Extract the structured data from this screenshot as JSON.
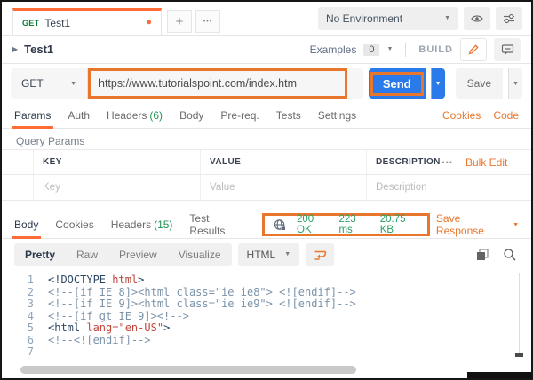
{
  "colors": {
    "accent_orange": "#ff6c37",
    "annotation_orange": "#e8762d",
    "link_orange": "#e8762d",
    "method_green": "#077d3a",
    "count_green": "#1f9254",
    "status_green": "#27a065",
    "send_blue": "#2a7be9"
  },
  "code_colors": {
    "tag": "#2c4964",
    "attr": "#c0473d",
    "string": "#c0473d",
    "comment": "#7b93a9",
    "line_number": "#8da4b8"
  },
  "icons": {
    "plus": "+",
    "more": "•••",
    "chevron": "▼",
    "dot": "●",
    "arrow": "▶",
    "menu": "•••"
  },
  "tabbar": {
    "tab_method": "GET",
    "tab_title": "Test1",
    "environment_selector": "No Environment"
  },
  "header": {
    "request_title": "Test1",
    "examples_label": "Examples",
    "examples_count": "0",
    "build_label": "BUILD"
  },
  "request_bar": {
    "method": "GET",
    "url": "https://www.tutorialspoint.com/index.htm",
    "send": "Send",
    "save": "Save"
  },
  "request_tabs": {
    "items": [
      {
        "label": "Params"
      },
      {
        "label": "Auth"
      },
      {
        "label": "Headers",
        "count": "(6)"
      },
      {
        "label": "Body"
      },
      {
        "label": "Pre-req."
      },
      {
        "label": "Tests"
      },
      {
        "label": "Settings"
      }
    ],
    "cookies": "Cookies",
    "code": "Code"
  },
  "query_params": {
    "title": "Query Params",
    "columns": {
      "key": "KEY",
      "value": "VALUE",
      "description": "DESCRIPTION"
    },
    "bulk_edit": "Bulk Edit",
    "placeholders": {
      "key": "Key",
      "value": "Value",
      "description": "Description"
    }
  },
  "response": {
    "tabs": [
      {
        "label": "Body"
      },
      {
        "label": "Cookies"
      },
      {
        "label": "Headers",
        "count": "(15)"
      },
      {
        "label": "Test Results"
      }
    ],
    "status": "200 OK",
    "time": "223 ms",
    "size": "20.75 KB",
    "save_response": "Save Response",
    "view_modes": [
      "Pretty",
      "Raw",
      "Preview",
      "Visualize"
    ],
    "format": "HTML"
  },
  "code_viewer": {
    "lines": [
      {
        "num": "1",
        "segments": [
          [
            "<!DOCTYPE ",
            "tag"
          ],
          [
            "html",
            "attr"
          ],
          [
            ">",
            "tag"
          ]
        ]
      },
      {
        "num": "2",
        "segments": [
          [
            "<!--[if IE 8]><html class=\"ie ie8\"> <![endif]-->",
            "comment"
          ]
        ]
      },
      {
        "num": "3",
        "segments": [
          [
            "<!--[if IE 9]><html class=\"ie ie9\"> <![endif]-->",
            "comment"
          ]
        ]
      },
      {
        "num": "4",
        "segments": [
          [
            "<!--[if gt IE 9]><!-->",
            "comment"
          ]
        ]
      },
      {
        "num": "5",
        "segments": [
          [
            "<html ",
            "tag"
          ],
          [
            "lang=",
            "attr"
          ],
          [
            "\"en-US\"",
            "string"
          ],
          [
            ">",
            "tag"
          ]
        ]
      },
      {
        "num": "6",
        "segments": [
          [
            "<!--<![endif]-->",
            "comment"
          ]
        ]
      },
      {
        "num": "7",
        "segments": []
      }
    ]
  }
}
